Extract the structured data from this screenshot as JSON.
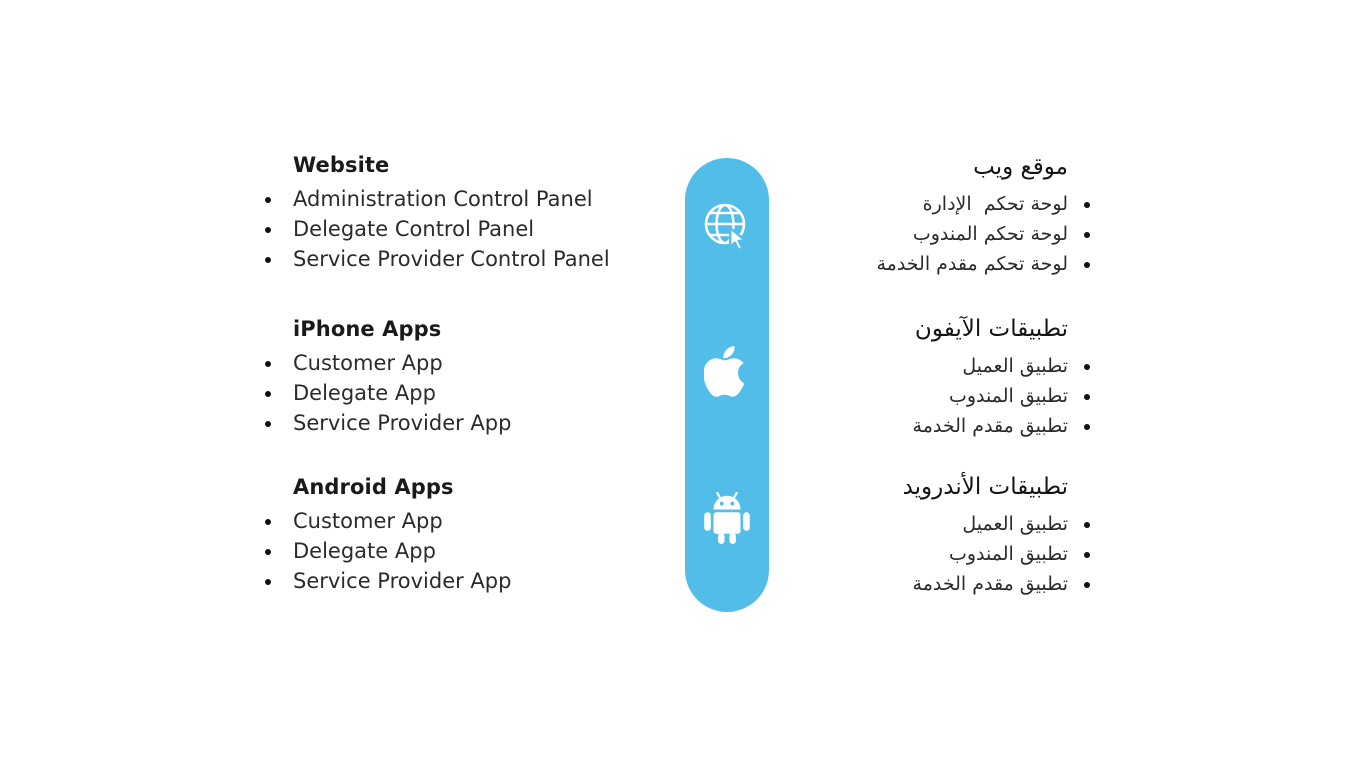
{
  "theme": {
    "background": "#ffffff",
    "accent": "#51bde8",
    "text": "#2b2b2b",
    "heading": "#141414",
    "bullet": "#111111"
  },
  "capsule": {
    "icons": [
      {
        "name": "globe-cursor-icon",
        "label": "Website"
      },
      {
        "name": "apple-logo-icon",
        "label": "iPhone"
      },
      {
        "name": "android-robot-icon",
        "label": "Android"
      }
    ]
  },
  "english": {
    "groups": [
      {
        "title": "Website",
        "items": [
          "Administration Control Panel",
          "Delegate Control Panel",
          "Service Provider Control Panel"
        ]
      },
      {
        "title": "iPhone Apps",
        "items": [
          "Customer App",
          "Delegate App",
          "Service Provider App"
        ]
      },
      {
        "title": "Android Apps",
        "items": [
          "Customer App",
          "Delegate App",
          "Service Provider App"
        ]
      }
    ]
  },
  "arabic": {
    "groups": [
      {
        "title": "موقع ويب",
        "items": [
          "لوحة تحكم  الإدارة",
          "لوحة تحكم المندوب",
          "لوحة تحكم مقدم الخدمة"
        ]
      },
      {
        "title": "تطبيقات الآيفون",
        "items": [
          "تطبيق العميل",
          "تطبيق المندوب",
          "تطبيق مقدم الخدمة"
        ]
      },
      {
        "title": "تطبيقات الأندرويد",
        "items": [
          "تطبيق العميل",
          "تطبيق المندوب",
          "تطبيق مقدم الخدمة"
        ]
      }
    ]
  }
}
